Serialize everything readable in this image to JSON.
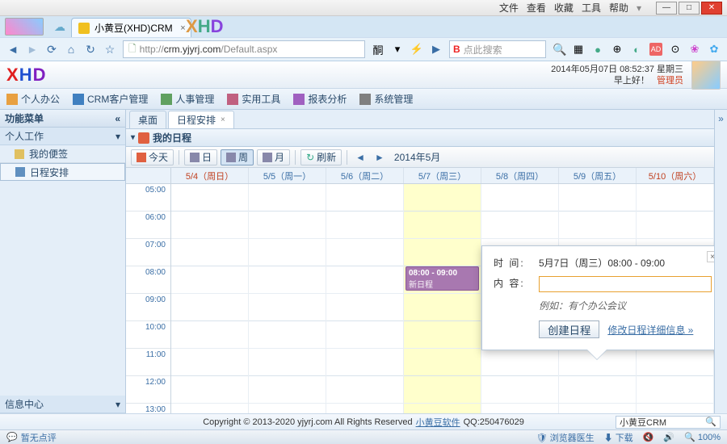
{
  "browser": {
    "menu": [
      "文件",
      "查看",
      "收藏",
      "工具",
      "帮助"
    ],
    "tab_title": "小黄豆(XHD)CRM",
    "url_prefix": "http://",
    "url_host": "crm.yjyrj.com",
    "url_path": "/Default.aspx",
    "search_placeholder": "点此搜索"
  },
  "header": {
    "datetime": "2014年05月07日 08:52:37 星期三",
    "greeting": "早上好！",
    "role": "管理员"
  },
  "main_nav": [
    "个人办公",
    "CRM客户管理",
    "人事管理",
    "实用工具",
    "报表分析",
    "系统管理"
  ],
  "sidebar": {
    "title": "功能菜单",
    "group": "个人工作",
    "items": [
      "我的便签",
      "日程安排"
    ],
    "bottom": "信息中心"
  },
  "tabs": {
    "desktop": "桌面",
    "schedule": "日程安排"
  },
  "panel_title": "我的日程",
  "toolbar": {
    "today": "今天",
    "day": "日",
    "week": "周",
    "month": "月",
    "refresh": "刷新",
    "date_label": "2014年5月"
  },
  "days": [
    {
      "label": "5/4（周日）",
      "weekend": true
    },
    {
      "label": "5/5（周一）"
    },
    {
      "label": "5/6（周二）"
    },
    {
      "label": "5/7（周三）",
      "today": true
    },
    {
      "label": "5/8（周四）"
    },
    {
      "label": "5/9（周五）"
    },
    {
      "label": "5/10（周六）",
      "weekend": true
    }
  ],
  "hours": [
    "05:00",
    "06:00",
    "07:00",
    "08:00",
    "09:00",
    "10:00",
    "11:00",
    "12:00",
    "13:00"
  ],
  "event": {
    "time": "08:00 - 09:00",
    "title": "新日程"
  },
  "popup": {
    "time_label": "时 间:",
    "time_value": "5月7日（周三）08:00 - 09:00",
    "content_label": "内 容:",
    "hint": "例如：有个办公会议",
    "create": "创建日程",
    "detail_link": "修改日程详细信息 »"
  },
  "footer": {
    "copyright": "Copyright © 2013-2020 yjyrj.com All Rights Reserved ",
    "link": "小黄豆软件",
    "qq": " QQ:250476029",
    "search": "小黄豆CRM"
  },
  "status": {
    "left": "暂无点评",
    "doctor": "浏览器医生",
    "download": "下载",
    "zoom": "100%"
  }
}
